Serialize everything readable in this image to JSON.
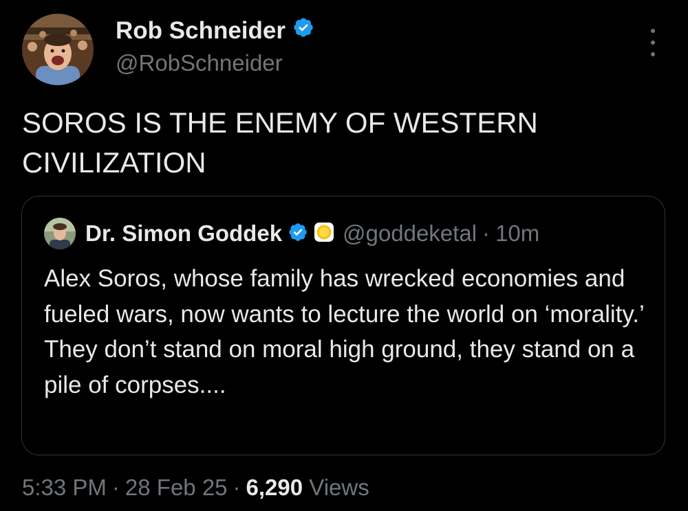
{
  "author": {
    "display_name": "Rob Schneider",
    "handle": "@RobSchneider",
    "avatar_icon": "profile-photo",
    "verified_icon": "verified-badge-icon"
  },
  "tweet": {
    "text": "SOROS IS THE ENEMY OF WESTERN CIVILIZATION"
  },
  "quoted_tweet": {
    "display_name": "Dr. Simon Goddek",
    "handle": "@goddeketal",
    "separator": "·",
    "time": "10m",
    "text": "Alex Soros, whose family has wrecked economies and fueled wars, now wants to lecture the world on ‘morality.’ They don’t stand on moral high ground, they stand on a pile of corpses....",
    "verified_icon": "verified-badge-icon",
    "affiliate_icon": "gold-coin-badge-icon"
  },
  "meta": {
    "time": "5:33 PM",
    "separator": "·",
    "date": "28 Feb 25",
    "views_count": "6,290",
    "views_label": "Views"
  },
  "colors": {
    "background": "#000000",
    "text_primary": "#e7e9ea",
    "text_secondary": "#71767b",
    "verified_blue": "#1d9bf0",
    "border": "#2f3336",
    "badge_gold": "#f5c518"
  }
}
